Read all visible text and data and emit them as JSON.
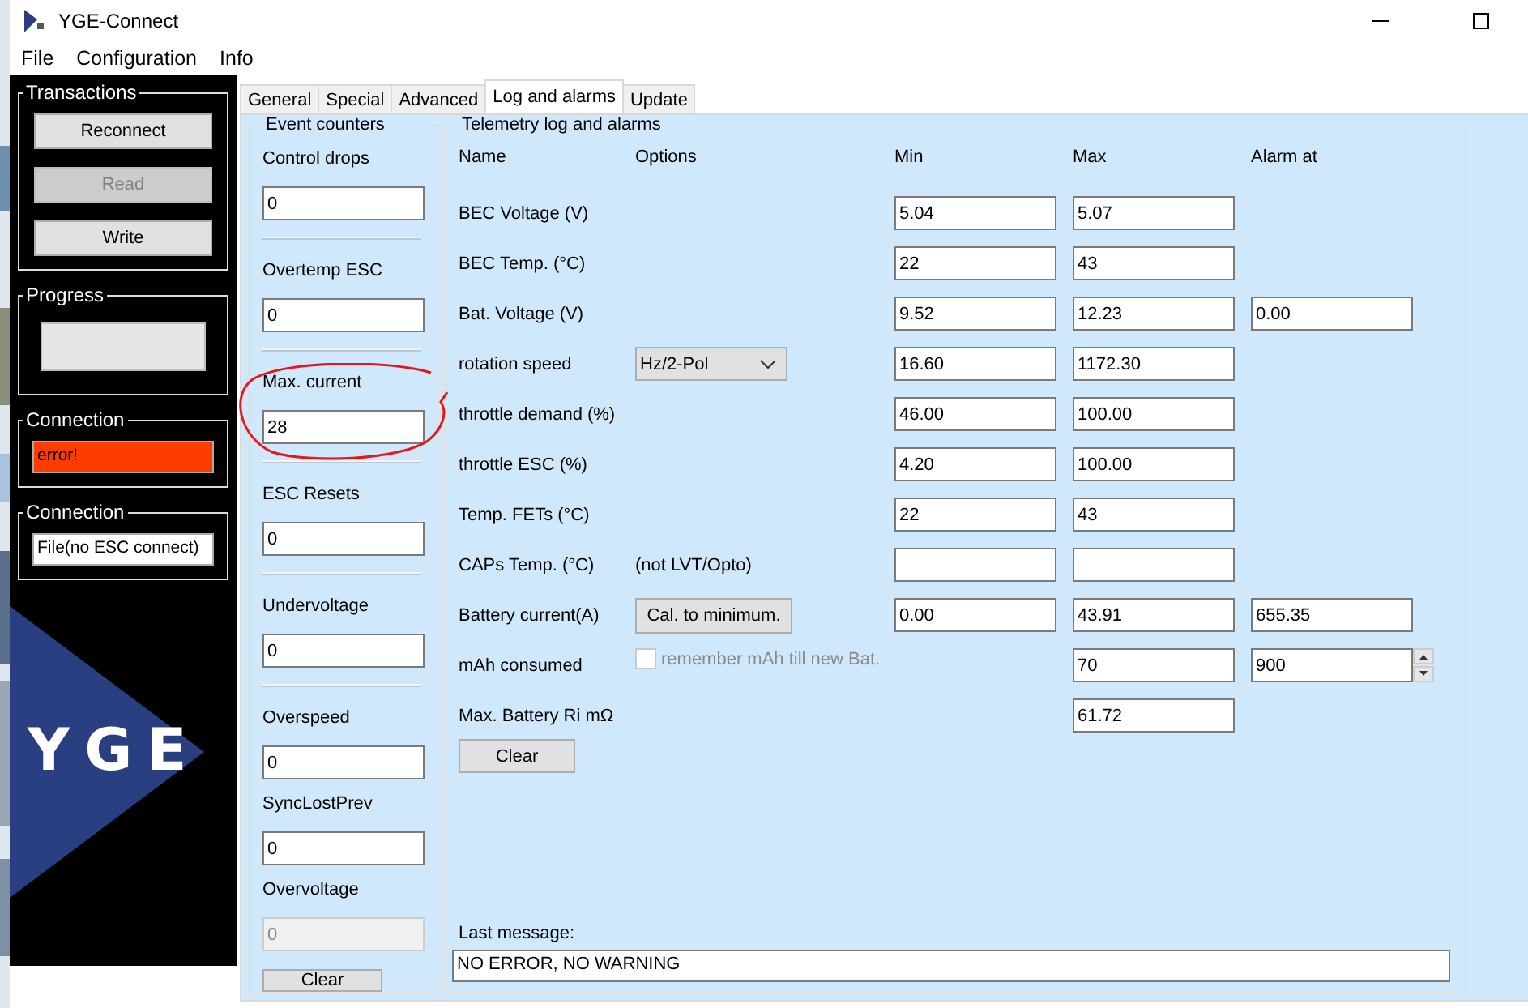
{
  "window": {
    "title": "YGE-Connect"
  },
  "menu": [
    "File",
    "Configuration",
    "Info"
  ],
  "sidebar": {
    "transactions": {
      "title": "Transactions",
      "buttons": [
        {
          "label": "Reconnect",
          "disabled": false
        },
        {
          "label": "Read",
          "disabled": true
        },
        {
          "label": "Write",
          "disabled": false
        }
      ]
    },
    "progress": {
      "title": "Progress",
      "level": 0
    },
    "connection": {
      "title": "Connection",
      "value": "error!",
      "error": true
    },
    "connection_mode": {
      "title": "Connection",
      "value": "File(no ESC connect)"
    },
    "logo": "YGE"
  },
  "tabs": [
    {
      "label": "General",
      "selected": false
    },
    {
      "label": "Special",
      "selected": false
    },
    {
      "label": "Advanced",
      "selected": false
    },
    {
      "label": "Log and alarms",
      "selected": true
    },
    {
      "label": "Update",
      "selected": false
    }
  ],
  "event_counters": {
    "title": "Event counters",
    "sections": [
      [
        {
          "label": "Control drops",
          "value": "0",
          "disabled": false
        }
      ],
      [
        {
          "label": "Overtemp ESC",
          "value": "0",
          "disabled": false
        }
      ],
      [
        {
          "label": "Max. current",
          "value": "28",
          "disabled": false
        }
      ],
      [
        {
          "label": "ESC Resets",
          "value": "0",
          "disabled": false
        }
      ],
      [
        {
          "label": "Undervoltage",
          "value": "0",
          "disabled": false
        }
      ],
      [
        {
          "label": "Overspeed",
          "value": "0",
          "disabled": false
        },
        {
          "label": "SyncLostPrev",
          "value": "0",
          "disabled": false
        },
        {
          "label": "Overvoltage",
          "value": "0",
          "disabled": true
        }
      ]
    ],
    "clear": "Clear"
  },
  "telemetry": {
    "title": "Telemetry log and alarms",
    "columns": [
      "Name",
      "Options",
      "Min",
      "Max",
      "Alarm at"
    ],
    "rows": [
      {
        "name": "BEC Voltage (V)",
        "min": "5.04",
        "max": "5.07"
      },
      {
        "name": "BEC Temp. (°C)",
        "min": "22",
        "max": "43"
      },
      {
        "name": "Bat. Voltage (V)",
        "min": "9.52",
        "max": "12.23",
        "alarm": "0.00"
      },
      {
        "name": "rotation speed",
        "option": {
          "kind": "dropdown",
          "value": "Hz/2-Pol"
        },
        "min": "16.60",
        "max": "1172.30"
      },
      {
        "name": "throttle demand (%)",
        "min": "46.00",
        "max": "100.00"
      },
      {
        "name": "throttle ESC (%)",
        "min": "4.20",
        "max": "100.00"
      },
      {
        "name": "Temp. FETs (°C)",
        "min": "22",
        "max": "43"
      },
      {
        "name": "CAPs Temp. (°C)",
        "option": {
          "kind": "note",
          "text": "(not LVT/Opto)"
        },
        "min": null,
        "max": null
      },
      {
        "name": "Battery current(A)",
        "option": {
          "kind": "button",
          "label": "Cal. to minimum."
        },
        "min": "0.00",
        "max": "43.91",
        "alarm": "655.35"
      },
      {
        "name": "mAh consumed",
        "option": {
          "kind": "checkbox",
          "label": "remember mAh till new Bat.",
          "checked": false,
          "disabled": true
        },
        "max": "70",
        "alarm": "900",
        "alarm_spinner": true
      },
      {
        "name": "Max. Battery Ri mΩ",
        "max": "61.72"
      }
    ],
    "clear": "Clear",
    "last_message_label": "Last message:",
    "last_message": "NO ERROR, NO WARNING"
  }
}
